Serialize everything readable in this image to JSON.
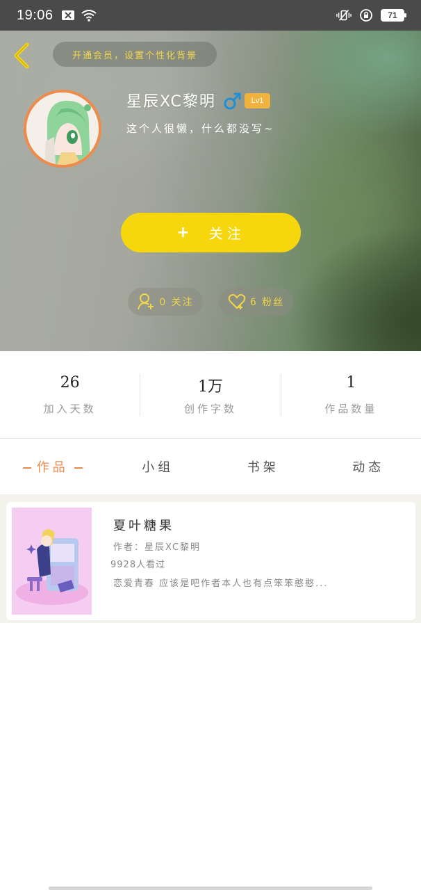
{
  "status_bar": {
    "time": "19:06",
    "battery": "71"
  },
  "header": {
    "vip_banner": "开通会员，设置个性化背景",
    "username": "星辰XC黎明",
    "gender_icon": "male-icon",
    "level": "Lv1",
    "bio": "这个人很懒，什么都没写~",
    "follow_button": "关注",
    "following_label": "0 关注",
    "fans_label": "6 粉丝",
    "accent_yellow": "#f6d70e",
    "accent_orange": "#f08a4b"
  },
  "stats": [
    {
      "value": "26",
      "label": "加入天数"
    },
    {
      "value": "1万",
      "label": "创作字数"
    },
    {
      "value": "1",
      "label": "作品数量"
    }
  ],
  "tabs": [
    {
      "label": "作品",
      "active": true
    },
    {
      "label": "小组",
      "active": false
    },
    {
      "label": "书架",
      "active": false
    },
    {
      "label": "动态",
      "active": false
    }
  ],
  "works": [
    {
      "title": "夏叶糖果",
      "author": "作者：星辰XC黎明",
      "views": "9928人看过",
      "intro": "恋爱青春 应该是吧作者本人也有点笨笨憨憨..."
    }
  ]
}
